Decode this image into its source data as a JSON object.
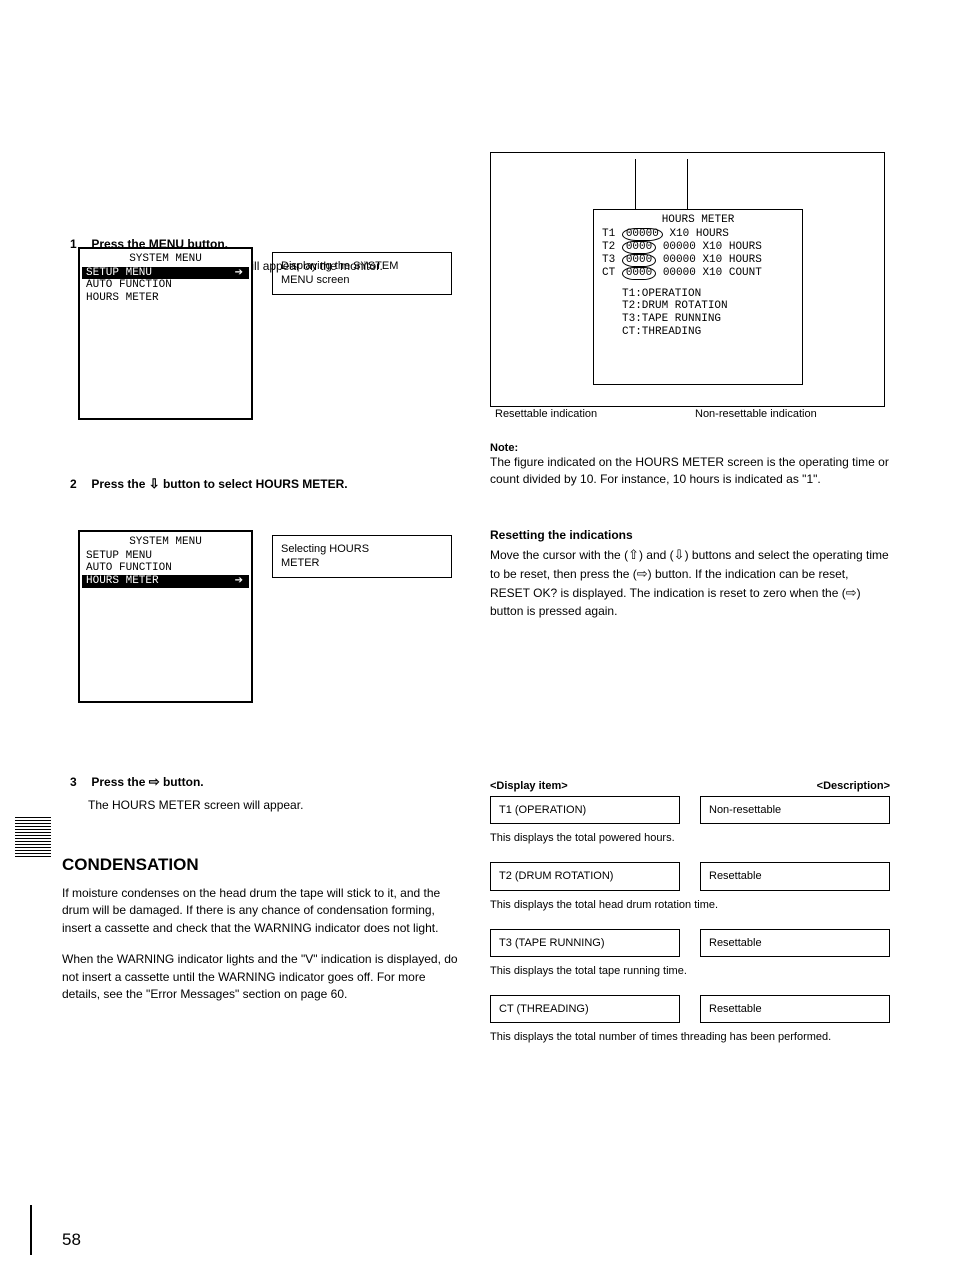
{
  "step1": {
    "num": "1",
    "text": "Press the MENU button.",
    "sub": "The SYSTEM MENU screen will appear on the monitor."
  },
  "vtr1": {
    "title": "SYSTEM MENU",
    "items": [
      "SETUP MENU",
      "AUTO FUNCTION",
      "HOURS METER"
    ],
    "selectedIndex": 0
  },
  "instr1": "Displaying the SYSTEM\nMENU screen",
  "step2": {
    "num": "2",
    "text_pre": "Press the ",
    "arrow": "⇩",
    "text_post": " button to select HOURS METER."
  },
  "vtr2": {
    "title": "SYSTEM MENU",
    "items": [
      "SETUP MENU",
      "AUTO FUNCTION",
      "HOURS METER"
    ],
    "selectedIndex": 2
  },
  "instr2": "Selecting HOURS\nMETER",
  "step3": {
    "num": "3",
    "text_pre": "Press the ",
    "arrow": "⇨",
    "text_post": " button.",
    "sub": "The HOURS METER screen will appear."
  },
  "cond_title": "CONDENSATION",
  "cond_p1": "If moisture condenses on the head drum the tape will stick to it, and the drum will be damaged. If there is any chance of condensation forming, insert a cassette and check that the WARNING indicator does not light.",
  "cond_p2": "When the WARNING indicator lights and the \"V\" indication is displayed, do not insert a cassette until the WARNING indicator goes off. For more details, see the \"Error Messages\" section on page 60.",
  "hours_title": "HOURS METER",
  "hours_rows": [
    {
      "k": "T1",
      "a": "    ",
      "b": "00000",
      "u": "X10 HOURS"
    },
    {
      "k": "T2",
      "a": "0000",
      "b": "00000",
      "u": "X10 HOURS"
    },
    {
      "k": "T3",
      "a": "0000",
      "b": "00000",
      "u": "X10 HOURS"
    },
    {
      "k": "CT",
      "a": "0000",
      "b": "00000",
      "u": "X10 COUNT"
    }
  ],
  "hours_legend": [
    "T1:OPERATION",
    "T2:DRUM ROTATION",
    "T3:TAPE RUNNING",
    "CT:THREADING"
  ],
  "callout_a": "Resettable indication",
  "callout_b": "Non-resettable indication",
  "reset_title": "Resetting the indications",
  "reset_p_pre": "Move the cursor with the ",
  "reset_arrow_up": "⇧",
  "reset_and": " and ",
  "reset_arrow_dn": "⇩",
  "reset_p_mid": " buttons and select the operating time to be reset, then press the ",
  "reset_arrow_rt": "⇨",
  "reset_p_post": " button. If the indication can be reset, RESET OK? is displayed. The indication is reset to zero when the (",
  "reset_arrow_rt2": "⇨",
  "reset_p_tail": ") button is pressed again.",
  "tables": [
    {
      "l": "T1 (OPERATION)",
      "r": "Non-resettable",
      "d": "This displays the total powered hours."
    },
    {
      "l": "T2 (DRUM ROTATION)",
      "r": "Resettable",
      "d": "This displays the total head drum rotation time."
    },
    {
      "l": "T3 (TAPE RUNNING)",
      "r": "Resettable",
      "d": "This displays the total tape running time."
    },
    {
      "l": "CT (THREADING)",
      "r": "Resettable",
      "d": "This displays the total number of times threading has been performed."
    }
  ],
  "footer_page": "58"
}
